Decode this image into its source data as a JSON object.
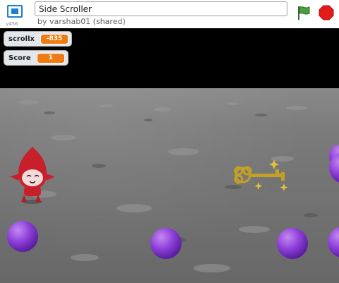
{
  "header": {
    "version": "v456",
    "project_title": "Side Scroller",
    "byline": "by varshab01 (shared)"
  },
  "icons": {
    "fullscreen": "fullscreen-icon",
    "green_flag": "green-flag-icon",
    "stop": "stop-sign-icon"
  },
  "monitors": {
    "scrollx": {
      "label": "scrollx",
      "value": "-835"
    },
    "score": {
      "label": "Score",
      "value": "1"
    }
  },
  "colors": {
    "accent_blue": "#1e7fd0",
    "flag_green": "#4a9e3e",
    "stop_red": "#e31b1b",
    "monitor_orange": "#f07b14",
    "ball_purple": "#8e3fd9",
    "key_gold": "#c4a024",
    "pico_red": "#c8202a"
  }
}
